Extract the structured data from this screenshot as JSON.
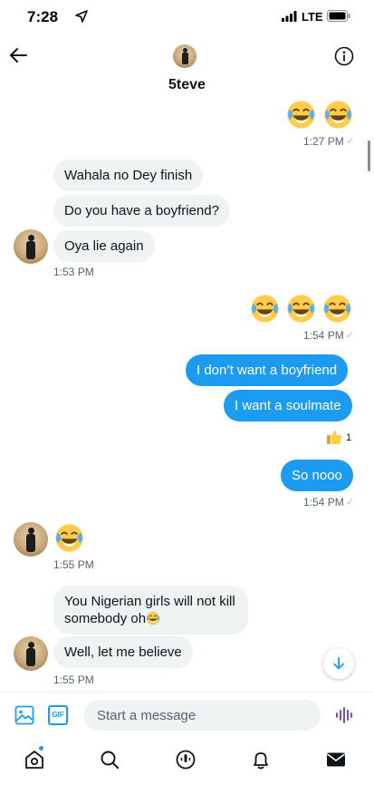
{
  "status_bar": {
    "time": "7:28",
    "network": "LTE",
    "icons": [
      "location-arrow-icon",
      "signal-icon",
      "battery-icon"
    ]
  },
  "header": {
    "contact_name": "5teve",
    "icons": [
      "back-arrow-icon",
      "info-icon"
    ]
  },
  "conversation": {
    "sent_1": {
      "emoji_count": 2,
      "emoji": "face-with-tears-of-joy",
      "time": "1:27 PM"
    },
    "received_1": {
      "messages": [
        "Wahala no Dey finish",
        "Do you have a boyfriend?",
        "Oya lie again"
      ],
      "time": "1:53 PM"
    },
    "sent_2": {
      "emoji_count": 3,
      "emoji": "face-with-tears-of-joy",
      "time": "1:54 PM"
    },
    "sent_3": {
      "messages": [
        "I don’t want a boyfriend",
        "I want a soulmate"
      ],
      "reaction_emoji": "thumbs-up",
      "reaction_count": "1"
    },
    "sent_4": {
      "messages": [
        "So nooo"
      ],
      "time": "1:54 PM"
    },
    "received_2": {
      "emoji": "face-with-tears-of-joy",
      "time": "1:55 PM"
    },
    "received_3": {
      "messages": [
        "You Nigerian girls will not kill\nsomebody oh",
        "Well, let me believe"
      ],
      "time": "1:55 PM"
    }
  },
  "composer": {
    "placeholder": "Start a message",
    "icons": [
      "image-icon",
      "gif-icon",
      "voice-icon"
    ],
    "gif_label": "GIF"
  },
  "tab_bar": {
    "tabs": [
      "home-icon",
      "search-icon",
      "spaces-icon",
      "notifications-icon",
      "messages-icon"
    ]
  },
  "colors": {
    "accent": "#1d9bf0",
    "incoming_bubble": "#eff3f4",
    "meta_text": "#536471"
  }
}
